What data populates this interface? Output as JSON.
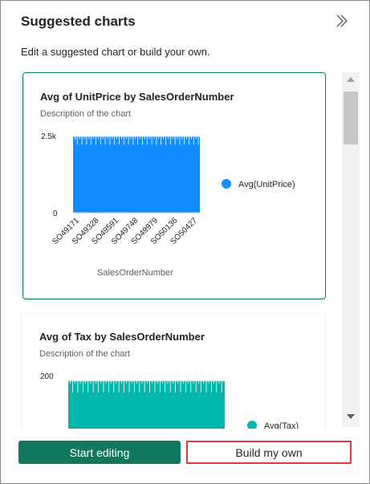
{
  "header": {
    "title": "Suggested charts",
    "subtitle": "Edit a suggested chart or build your own."
  },
  "colors": {
    "accent": "#11785d",
    "chart1": "#118dff",
    "chart2": "#01b8aa",
    "highlight": "#e0383d"
  },
  "cards": [
    {
      "title": "Avg of UnitPrice by SalesOrderNumber",
      "description": "Description of the chart",
      "legend_label": "Avg(UnitPrice)",
      "x_axis_title": "SalesOrderNumber",
      "y_ticks": [
        "2.5k",
        "0"
      ],
      "x_ticks": [
        "SO49171",
        "SO49328",
        "SO49591",
        "SO49748",
        "SO49979",
        "SO50136",
        "SO50427"
      ]
    },
    {
      "title": "Avg of Tax by SalesOrderNumber",
      "description": "Description of the chart",
      "legend_label": "Avg(Tax)",
      "y_ticks": [
        "200"
      ]
    }
  ],
  "chart_data": [
    {
      "type": "bar",
      "title": "Avg of UnitPrice by SalesOrderNumber",
      "xlabel": "SalesOrderNumber",
      "ylabel": "",
      "ylim": [
        0,
        2500
      ],
      "categories": [
        "SO49171",
        "SO49328",
        "SO49591",
        "SO49748",
        "SO49979",
        "SO50136",
        "SO50427"
      ],
      "series": [
        {
          "name": "Avg(UnitPrice)",
          "values": [
            2440,
            2440,
            2440,
            2440,
            2440,
            2440,
            2440
          ]
        }
      ]
    },
    {
      "type": "bar",
      "title": "Avg of Tax by SalesOrderNumber",
      "ylim": [
        0,
        200
      ],
      "categories": [],
      "series": [
        {
          "name": "Avg(Tax)",
          "values": [
            195
          ]
        }
      ]
    }
  ],
  "buttons": {
    "start_editing": "Start editing",
    "build_my_own": "Build my own"
  }
}
